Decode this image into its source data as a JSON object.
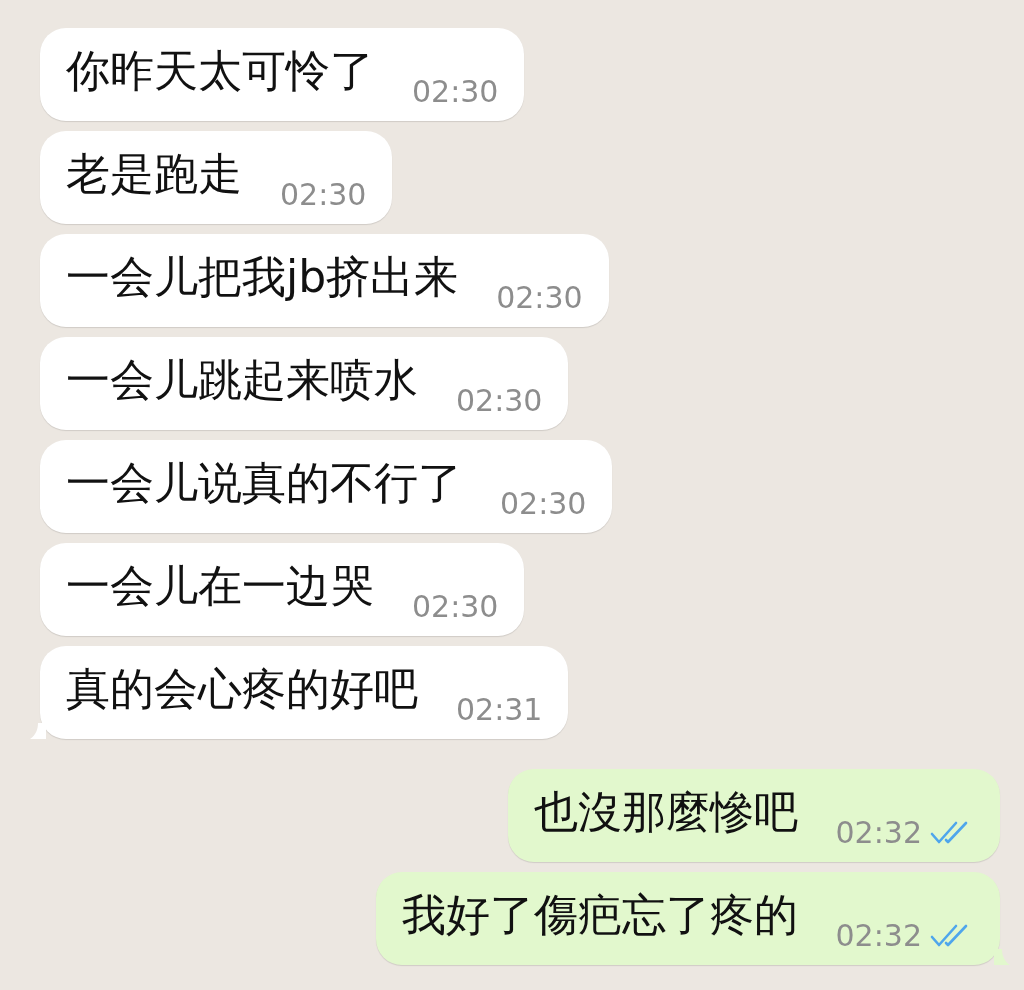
{
  "messages": [
    {
      "kind": "incoming",
      "text": "你昨天太可怜了",
      "time": "02:30",
      "tail": false
    },
    {
      "kind": "incoming",
      "text": "老是跑走",
      "time": "02:30",
      "tail": false
    },
    {
      "kind": "incoming",
      "text": "一会儿把我jb挤出来",
      "time": "02:30",
      "tail": false
    },
    {
      "kind": "incoming",
      "text": "一会儿跳起来喷水",
      "time": "02:30",
      "tail": false
    },
    {
      "kind": "incoming",
      "text": "一会儿说真的不行了",
      "time": "02:30",
      "tail": false
    },
    {
      "kind": "incoming",
      "text": "一会儿在一边哭",
      "time": "02:30",
      "tail": false
    },
    {
      "kind": "incoming",
      "text": "真的会心疼的好吧",
      "time": "02:31",
      "tail": true
    },
    {
      "kind": "outgoing",
      "text": "也沒那麼慘吧",
      "time": "02:32",
      "read": true,
      "tail": false
    },
    {
      "kind": "outgoing",
      "text": "我好了傷疤忘了疼的",
      "time": "02:32",
      "read": true,
      "tail": true
    }
  ]
}
